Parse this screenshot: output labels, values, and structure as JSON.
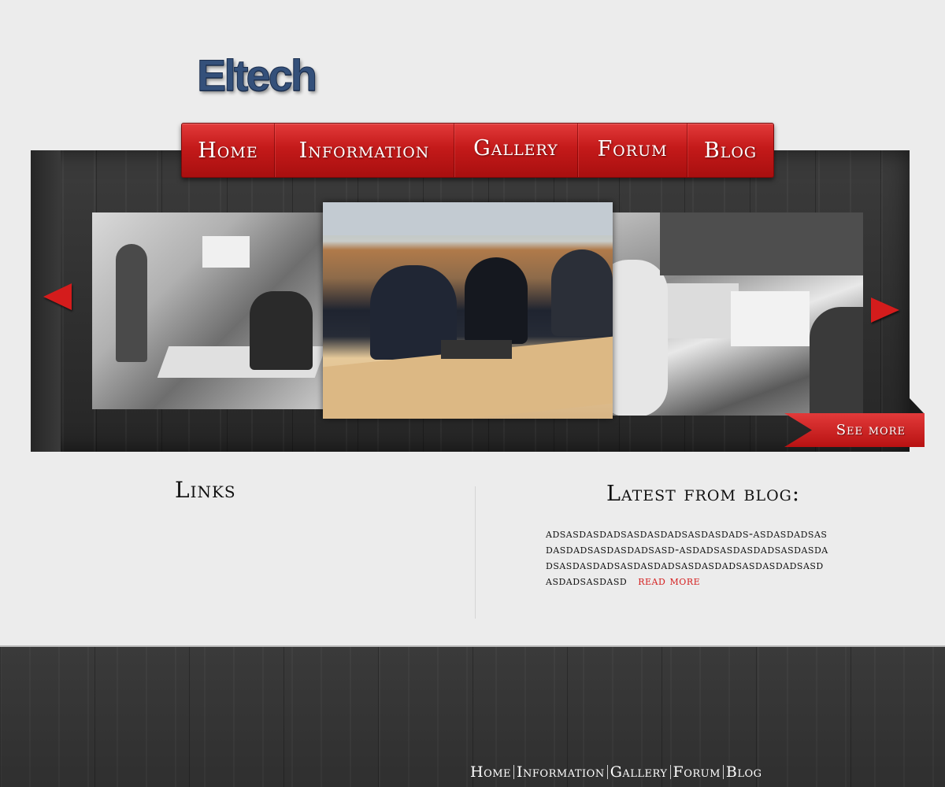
{
  "logo": {
    "text": "Eltech"
  },
  "nav": {
    "items": [
      {
        "label": "Home"
      },
      {
        "label": "Information"
      },
      {
        "label": "Gallery"
      },
      {
        "label": "Forum"
      },
      {
        "label": "Blog"
      }
    ]
  },
  "slider": {
    "see_more_label": "See more",
    "prev_icon": "arrow-left-icon",
    "next_icon": "arrow-right-icon"
  },
  "links": {
    "heading": "Links"
  },
  "blog": {
    "heading": "Latest from blog:",
    "text": "adsasdasdadsasdasdadsasdasdads-asdasdadsasdasdadsasdasdadsasd-asdadsasdasdadsasdasdadsasdasdadsasdasdadsasdasdadsasdasdadsasdasdadsasdasd",
    "read_more": "read more"
  },
  "footer": {
    "nav": [
      {
        "label": "Home"
      },
      {
        "label": "Information"
      },
      {
        "label": "Gallery"
      },
      {
        "label": "Forum"
      },
      {
        "label": "Blog"
      }
    ]
  },
  "colors": {
    "accent_red": "#c41a1a",
    "logo_blue": "#34507a",
    "dark_wood": "#2e2e2e",
    "background": "#ececec"
  }
}
